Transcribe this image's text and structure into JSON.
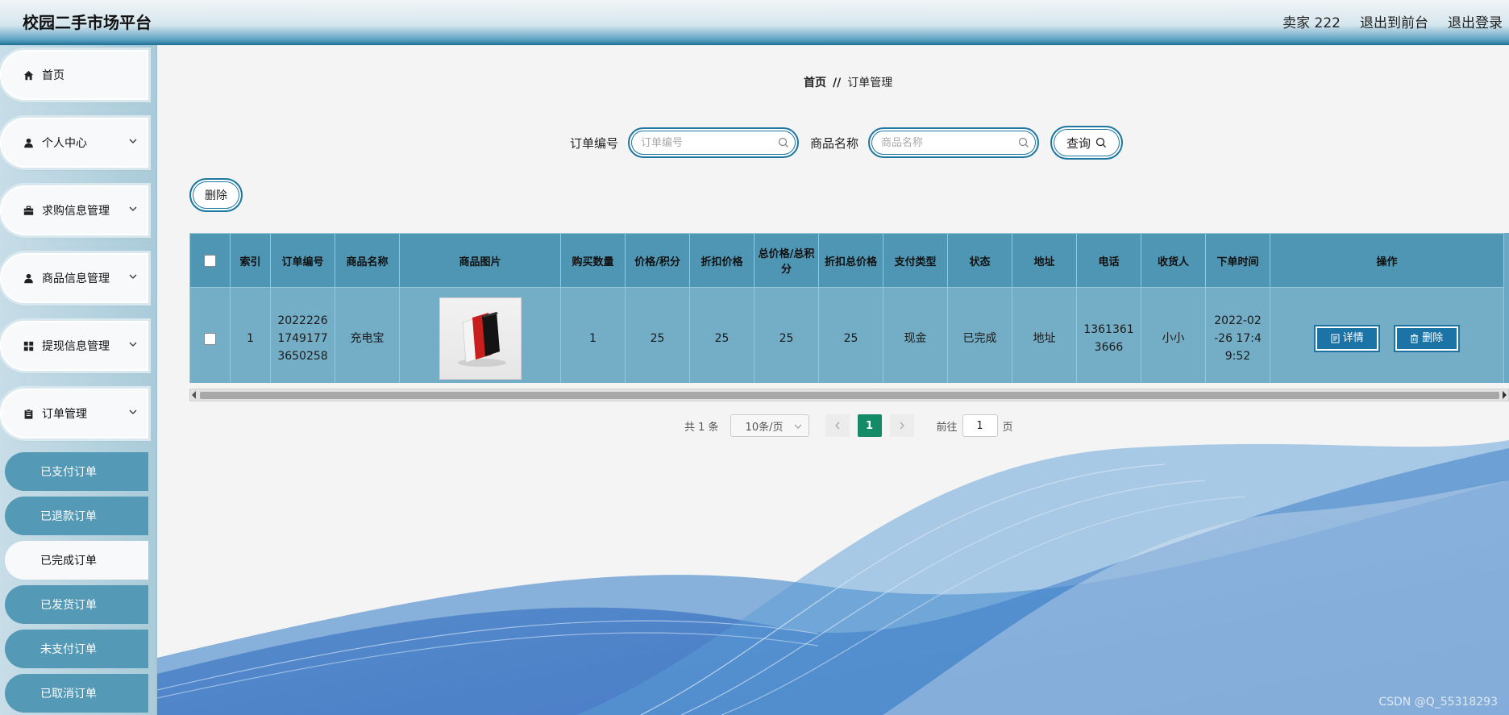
{
  "header": {
    "app_title": "校园二手市场平台",
    "user": "卖家 222",
    "back_to_front": "退出到前台",
    "logout": "退出登录"
  },
  "sidebar": {
    "items": [
      {
        "label": "首页",
        "icon": "home-icon"
      },
      {
        "label": "个人中心",
        "icon": "user-icon"
      },
      {
        "label": "求购信息管理",
        "icon": "briefcase-icon"
      },
      {
        "label": "商品信息管理",
        "icon": "user-icon"
      },
      {
        "label": "提现信息管理",
        "icon": "grid-icon"
      },
      {
        "label": "订单管理",
        "icon": "clipboard-icon"
      }
    ],
    "sub_items": [
      {
        "label": "已支付订单"
      },
      {
        "label": "已退款订单"
      },
      {
        "label": "已完成订单",
        "active": true
      },
      {
        "label": "已发货订单"
      },
      {
        "label": "未支付订单"
      },
      {
        "label": "已取消订单"
      }
    ]
  },
  "breadcrumb": {
    "home": "首页",
    "separator": "//",
    "current": "订单管理"
  },
  "search": {
    "order_no_label": "订单编号",
    "order_no_placeholder": "订单编号",
    "product_name_label": "商品名称",
    "product_name_placeholder": "商品名称",
    "query_label": "查询"
  },
  "toolbar": {
    "delete_label": "删除"
  },
  "table": {
    "headers": [
      "索引",
      "订单编号",
      "商品名称",
      "商品图片",
      "购买数量",
      "价格/积分",
      "折扣价格",
      "总价格/总积分",
      "折扣总价格",
      "支付类型",
      "状态",
      "地址",
      "电话",
      "收货人",
      "下单时间",
      "操作"
    ],
    "rows": [
      {
        "index": "1",
        "order_no": "20222261749177365025 8",
        "order_no_lines": [
          "2022226",
          "1749177",
          "3650258"
        ],
        "product_name": "充电宝",
        "quantity": "1",
        "price": "25",
        "discount_price": "25",
        "total_price": "25",
        "discount_total": "25",
        "pay_type": "现金",
        "status": "已完成",
        "address": "地址",
        "phone_lines": [
          "1361361",
          "3666"
        ],
        "receiver": "小小",
        "time_lines": [
          "2022-02",
          "-26 17:4",
          "9:52"
        ],
        "detail_label": "详情",
        "delete_label": "删除"
      }
    ]
  },
  "pager": {
    "total": "共 1 条",
    "page_size": "10条/页",
    "current_page": "1",
    "goto_label": "前往",
    "goto_value": "1",
    "page_unit": "页"
  },
  "watermark": "CSDN @Q_55318293",
  "colors": {
    "accent": "#1d77a1",
    "table_header": "#4f96b4",
    "table_row": "#73adc6",
    "pager_active": "#148b66"
  }
}
